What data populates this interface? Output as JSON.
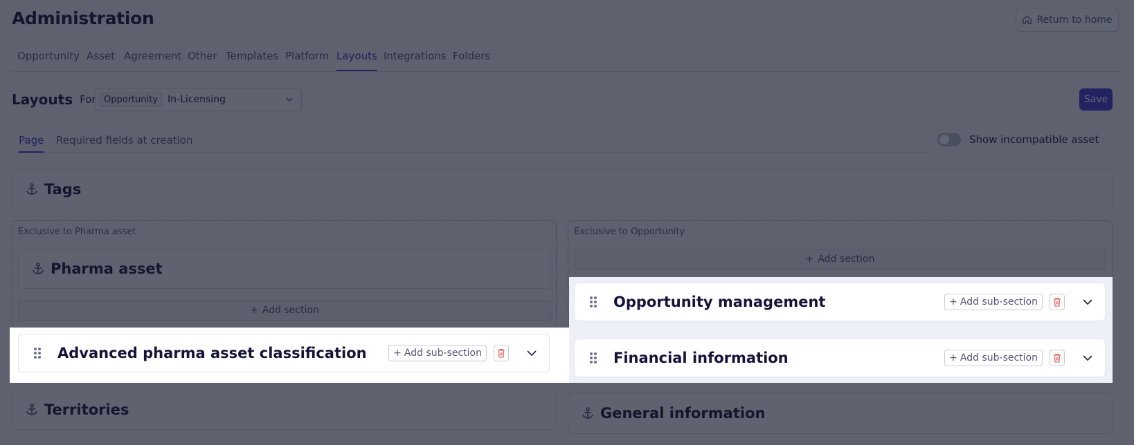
{
  "header": {
    "title": "Administration",
    "return_label": "Return to home"
  },
  "tabs": [
    {
      "label": "Opportunity",
      "active": false
    },
    {
      "label": "Asset",
      "active": false
    },
    {
      "label": "Agreement",
      "active": false
    },
    {
      "label": "Other",
      "active": false
    },
    {
      "label": "Templates",
      "active": false
    },
    {
      "label": "Platform",
      "active": false
    },
    {
      "label": "Layouts",
      "active": true
    },
    {
      "label": "Integrations",
      "active": false
    },
    {
      "label": "Folders",
      "active": false
    }
  ],
  "layouts": {
    "title": "Layouts",
    "for_label": "For",
    "select_chip": "Opportunity",
    "select_value": "In-Licensing",
    "save_label": "Save"
  },
  "subtabs": [
    {
      "label": "Page",
      "active": true
    },
    {
      "label": "Required fields at creation",
      "active": false
    }
  ],
  "toggle": {
    "label": "Show incompatible asset",
    "on": false
  },
  "sections": {
    "tags": "Tags",
    "pharma_zone_label": "Exclusive to Pharma asset",
    "pharma_asset": "Pharma asset",
    "add_section": "Add section",
    "advanced": "Advanced pharma asset classification",
    "opp_zone_label": "Exclusive to Opportunity",
    "opp_management": "Opportunity management",
    "financial": "Financial information",
    "add_sub_section": "Add sub-section",
    "territories": "Territories",
    "general": "General information"
  },
  "colors": {
    "accent": "#4039d6",
    "danger": "#e05252",
    "overlay": "rgba(20,24,40,0.42)"
  }
}
